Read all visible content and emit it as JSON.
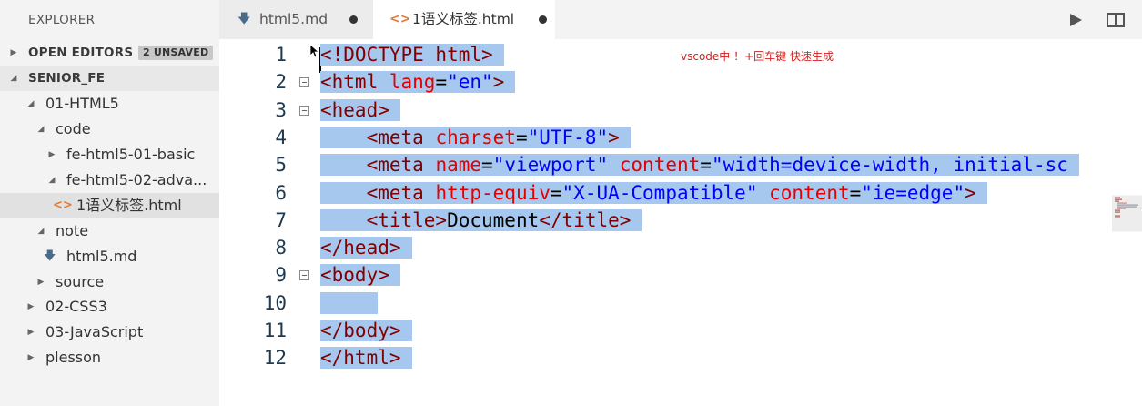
{
  "explorer": {
    "title": "EXPLORER",
    "open_editors": {
      "label": "OPEN EDITORS",
      "badge": "2 UNSAVED"
    },
    "project": "SENIOR_FE",
    "tree": [
      {
        "label": "01-HTML5",
        "expanded": true
      },
      {
        "label": "code",
        "expanded": true
      },
      {
        "label": "fe-html5-01-basic",
        "expanded": false
      },
      {
        "label": "fe-html5-02-adva...",
        "expanded": true
      },
      {
        "label": "1语义标签.html",
        "icon": "html-file-icon",
        "selected": true
      },
      {
        "label": "note",
        "expanded": true
      },
      {
        "label": "html5.md",
        "icon": "markdown-file-icon"
      },
      {
        "label": "source",
        "expanded": false
      },
      {
        "label": "02-CSS3",
        "expanded": false
      },
      {
        "label": "03-JavaScript",
        "expanded": false
      },
      {
        "label": "plesson",
        "expanded": false
      }
    ]
  },
  "tabs": [
    {
      "label": "html5.md",
      "icon": "markdown-file-icon",
      "unsaved": true,
      "active": false
    },
    {
      "label": "1语义标签.html",
      "icon": "html-file-icon",
      "unsaved": true,
      "active": true
    }
  ],
  "editor": {
    "annotation": "vscode中 ！+回车键  快速生成",
    "line_numbers": [
      "1",
      "2",
      "3",
      "4",
      "5",
      "6",
      "7",
      "8",
      "9",
      "10",
      "11",
      "12"
    ],
    "lines": [
      [
        [
          "tag",
          "<!DOCTYPE html>"
        ]
      ],
      [
        [
          "tag",
          "<html "
        ],
        [
          "attr",
          "lang"
        ],
        [
          "txt",
          "="
        ],
        [
          "str",
          "\"en\""
        ],
        [
          "tag",
          ">"
        ]
      ],
      [
        [
          "tag",
          "<head>"
        ]
      ],
      [
        [
          "txt",
          "    "
        ],
        [
          "tag",
          "<meta "
        ],
        [
          "attr",
          "charset"
        ],
        [
          "txt",
          "="
        ],
        [
          "str",
          "\"UTF-8\""
        ],
        [
          "tag",
          ">"
        ]
      ],
      [
        [
          "txt",
          "    "
        ],
        [
          "tag",
          "<meta "
        ],
        [
          "attr",
          "name"
        ],
        [
          "txt",
          "="
        ],
        [
          "str",
          "\"viewport\""
        ],
        [
          "txt",
          " "
        ],
        [
          "attr",
          "content"
        ],
        [
          "txt",
          "="
        ],
        [
          "str",
          "\"width=device-width, initial-sc"
        ]
      ],
      [
        [
          "txt",
          "    "
        ],
        [
          "tag",
          "<meta "
        ],
        [
          "attr",
          "http-equiv"
        ],
        [
          "txt",
          "="
        ],
        [
          "str",
          "\"X-UA-Compatible\""
        ],
        [
          "txt",
          " "
        ],
        [
          "attr",
          "content"
        ],
        [
          "txt",
          "="
        ],
        [
          "str",
          "\"ie=edge\""
        ],
        [
          "tag",
          ">"
        ]
      ],
      [
        [
          "txt",
          "    "
        ],
        [
          "tag",
          "<title>"
        ],
        [
          "txt",
          "Document"
        ],
        [
          "tag",
          "</title>"
        ]
      ],
      [
        [
          "tag",
          "</head>"
        ]
      ],
      [
        [
          "tag",
          "<body>"
        ]
      ],
      [
        [
          "txt",
          "    "
        ]
      ],
      [
        [
          "tag",
          "</body>"
        ]
      ],
      [
        [
          "tag",
          "</html>"
        ]
      ]
    ]
  },
  "colors": {
    "selection": "#a7c8ee",
    "tag": "#800000",
    "attribute": "#e50000",
    "string": "#0000ff",
    "line_number": "#1f3a4f",
    "html_icon": "#e37933",
    "markdown_icon": "#4a6a8a"
  }
}
